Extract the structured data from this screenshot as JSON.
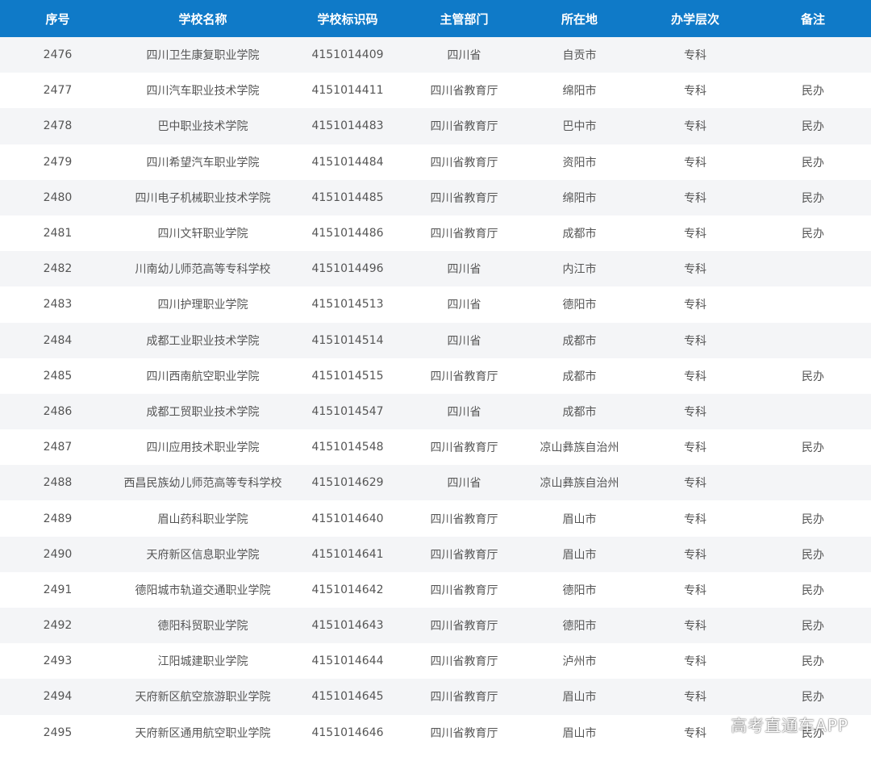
{
  "table": {
    "headers": [
      "序号",
      "学校名称",
      "学校标识码",
      "主管部门",
      "所在地",
      "办学层次",
      "备注"
    ],
    "rows": [
      [
        "2476",
        "四川卫生康复职业学院",
        "4151014409",
        "四川省",
        "自贡市",
        "专科",
        ""
      ],
      [
        "2477",
        "四川汽车职业技术学院",
        "4151014411",
        "四川省教育厅",
        "绵阳市",
        "专科",
        "民办"
      ],
      [
        "2478",
        "巴中职业技术学院",
        "4151014483",
        "四川省教育厅",
        "巴中市",
        "专科",
        "民办"
      ],
      [
        "2479",
        "四川希望汽车职业学院",
        "4151014484",
        "四川省教育厅",
        "资阳市",
        "专科",
        "民办"
      ],
      [
        "2480",
        "四川电子机械职业技术学院",
        "4151014485",
        "四川省教育厅",
        "绵阳市",
        "专科",
        "民办"
      ],
      [
        "2481",
        "四川文轩职业学院",
        "4151014486",
        "四川省教育厅",
        "成都市",
        "专科",
        "民办"
      ],
      [
        "2482",
        "川南幼儿师范高等专科学校",
        "4151014496",
        "四川省",
        "内江市",
        "专科",
        ""
      ],
      [
        "2483",
        "四川护理职业学院",
        "4151014513",
        "四川省",
        "德阳市",
        "专科",
        ""
      ],
      [
        "2484",
        "成都工业职业技术学院",
        "4151014514",
        "四川省",
        "成都市",
        "专科",
        ""
      ],
      [
        "2485",
        "四川西南航空职业学院",
        "4151014515",
        "四川省教育厅",
        "成都市",
        "专科",
        "民办"
      ],
      [
        "2486",
        "成都工贸职业技术学院",
        "4151014547",
        "四川省",
        "成都市",
        "专科",
        ""
      ],
      [
        "2487",
        "四川应用技术职业学院",
        "4151014548",
        "四川省教育厅",
        "凉山彝族自治州",
        "专科",
        "民办"
      ],
      [
        "2488",
        "西昌民族幼儿师范高等专科学校",
        "4151014629",
        "四川省",
        "凉山彝族自治州",
        "专科",
        ""
      ],
      [
        "2489",
        "眉山药科职业学院",
        "4151014640",
        "四川省教育厅",
        "眉山市",
        "专科",
        "民办"
      ],
      [
        "2490",
        "天府新区信息职业学院",
        "4151014641",
        "四川省教育厅",
        "眉山市",
        "专科",
        "民办"
      ],
      [
        "2491",
        "德阳城市轨道交通职业学院",
        "4151014642",
        "四川省教育厅",
        "德阳市",
        "专科",
        "民办"
      ],
      [
        "2492",
        "德阳科贸职业学院",
        "4151014643",
        "四川省教育厅",
        "德阳市",
        "专科",
        "民办"
      ],
      [
        "2493",
        "江阳城建职业学院",
        "4151014644",
        "四川省教育厅",
        "泸州市",
        "专科",
        "民办"
      ],
      [
        "2494",
        "天府新区航空旅游职业学院",
        "4151014645",
        "四川省教育厅",
        "眉山市",
        "专科",
        "民办"
      ],
      [
        "2495",
        "天府新区通用航空职业学院",
        "4151014646",
        "四川省教育厅",
        "眉山市",
        "专科",
        "民办"
      ]
    ]
  },
  "watermark": "高考直通车APP",
  "colors": {
    "header_bg": "#0f7ac8",
    "header_text": "#ffffff",
    "row_alt_bg": "#f4f5f7",
    "cell_text": "#555555"
  }
}
